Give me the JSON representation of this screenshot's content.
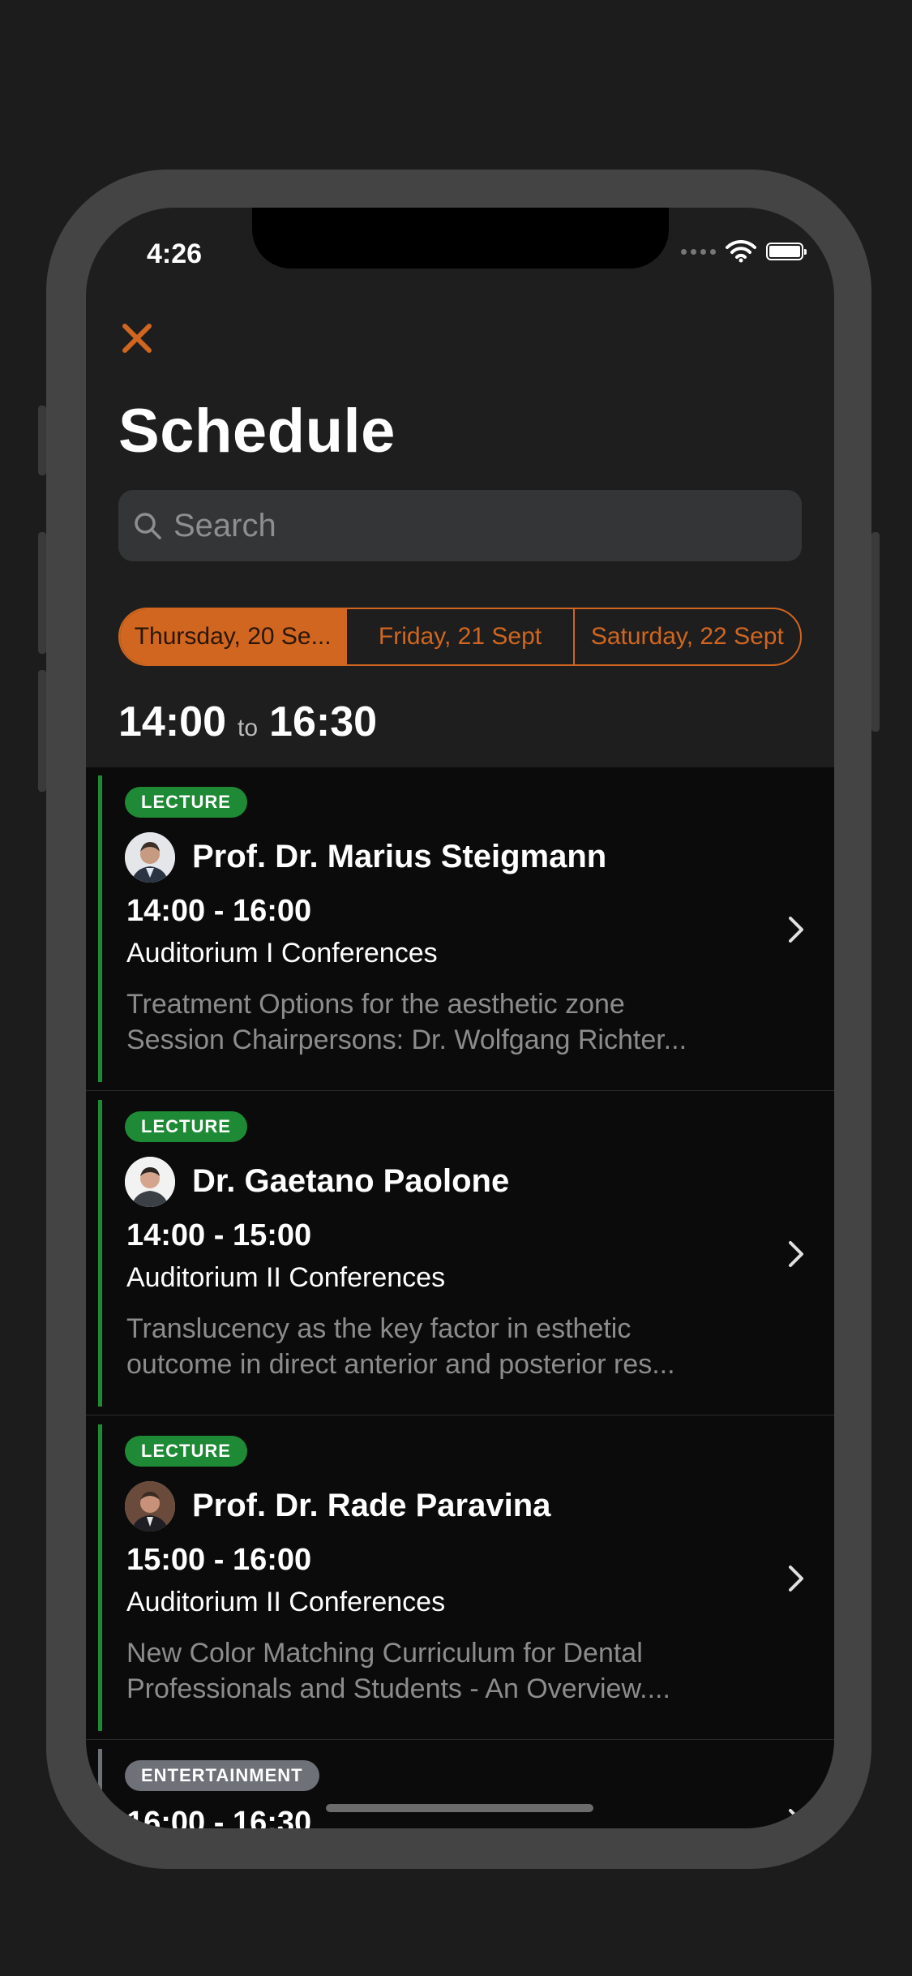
{
  "status": {
    "time": "4:26"
  },
  "header": {
    "title": "Schedule"
  },
  "search": {
    "placeholder": "Search"
  },
  "days": [
    {
      "label": "Thursday, 20 Se...",
      "active": true
    },
    {
      "label": "Friday, 21 Sept",
      "active": false
    },
    {
      "label": "Saturday, 22 Sept",
      "active": false
    }
  ],
  "slot": {
    "start": "14:00",
    "to": "to",
    "end": "16:30"
  },
  "sessions": [
    {
      "badge": "LECTURE",
      "speaker": "Prof. Dr. Marius Steigmann",
      "time": "14:00 - 16:00",
      "room": "Auditorium I Conferences",
      "desc_line1": "Treatment Options for the aesthetic zone",
      "desc_line2": "Session Chairpersons: Dr. Wolfgang Richter..."
    },
    {
      "badge": "LECTURE",
      "speaker": "Dr. Gaetano Paolone",
      "time": "14:00 - 15:00",
      "room": "Auditorium II Conferences",
      "desc_line1": "Translucency as the key factor in esthetic",
      "desc_line2": "outcome in direct anterior and posterior res..."
    },
    {
      "badge": "LECTURE",
      "speaker": "Prof. Dr. Rade Paravina",
      "time": "15:00 - 16:00",
      "room": "Auditorium II Conferences",
      "desc_line1": "New Color Matching Curriculum for Dental",
      "desc_line2": "Professionals and Students - An Overview...."
    },
    {
      "badge": "ENTERTAINMENT",
      "time": "16:00 - 16:30"
    }
  ],
  "colors": {
    "accent": "#d0661f",
    "lecture": "#1f8a36",
    "entertainment": "#6e7178"
  },
  "icons": [
    "close-icon",
    "search-icon",
    "wifi-icon",
    "battery-icon",
    "chevron-right-icon"
  ]
}
